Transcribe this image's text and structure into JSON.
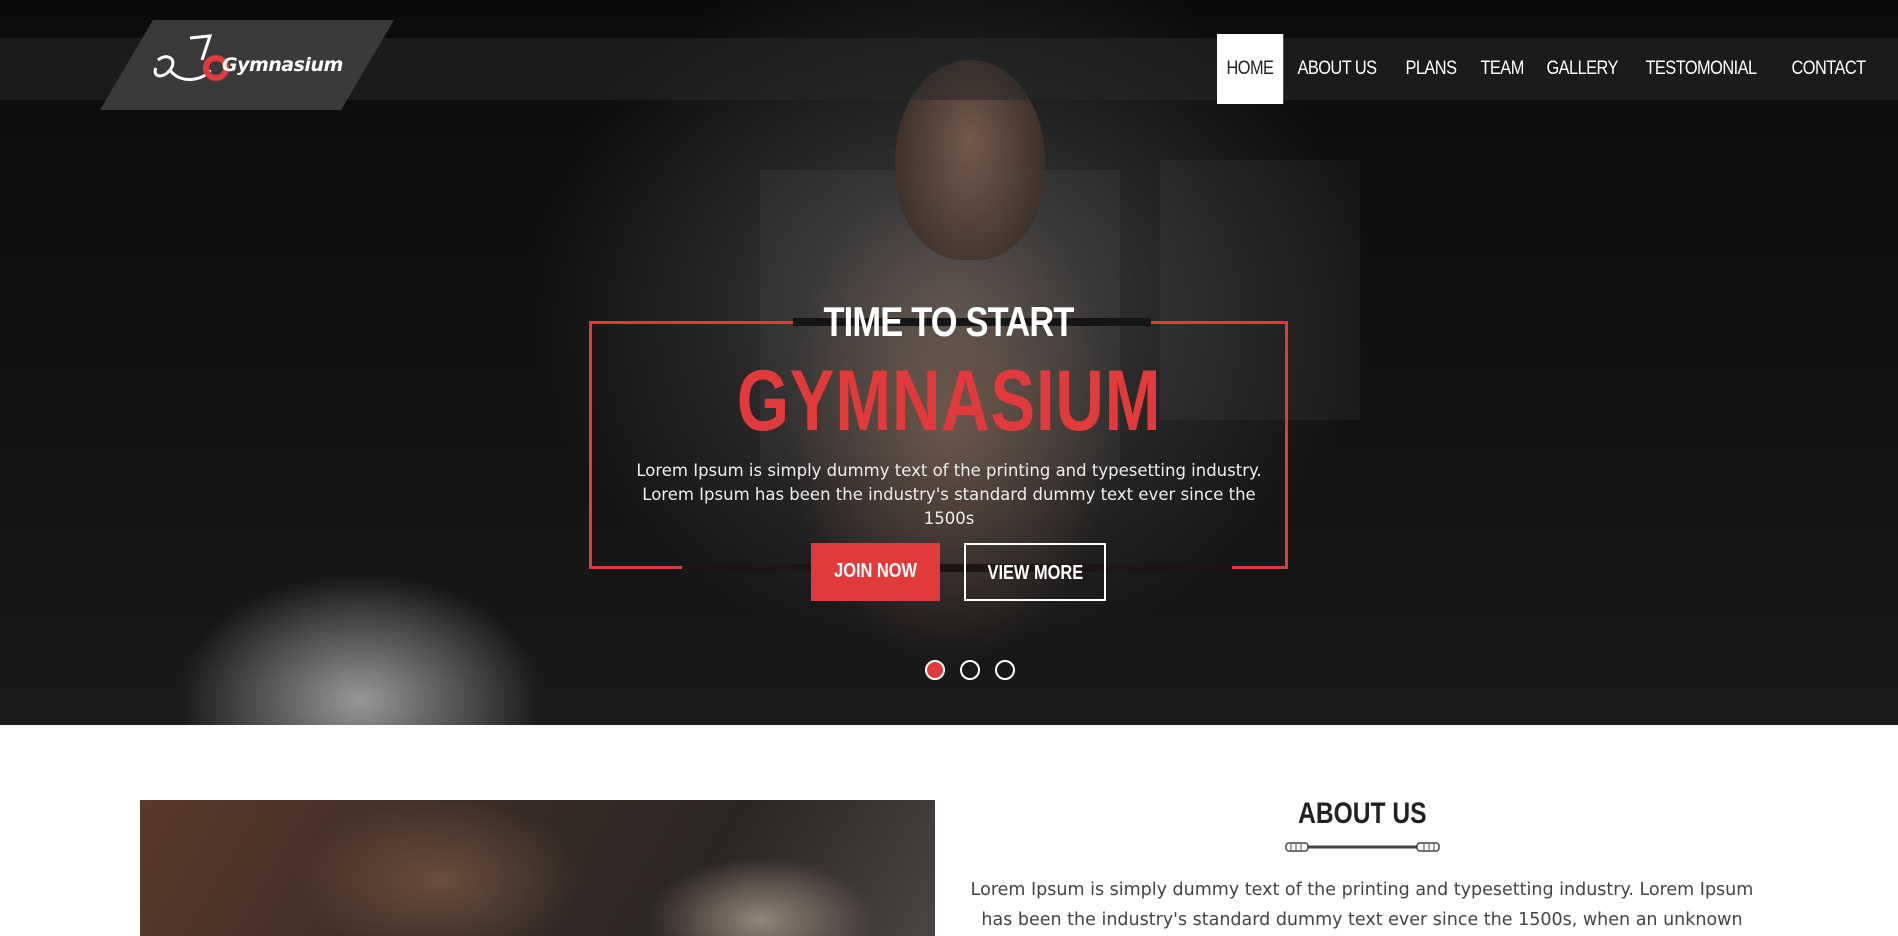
{
  "brand": {
    "logo_text": "Gymnasium"
  },
  "nav": {
    "items": [
      {
        "label": "HOME",
        "active": true
      },
      {
        "label": "ABOUT US",
        "active": false
      },
      {
        "label": "PLANS",
        "active": false
      },
      {
        "label": "TEAM",
        "active": false
      },
      {
        "label": "GALLERY",
        "active": false
      },
      {
        "label": "TESTOMONIAL",
        "active": false
      },
      {
        "label": "CONTACT",
        "active": false
      }
    ]
  },
  "hero": {
    "kicker": "TIME TO START",
    "title": "GYMNASIUM",
    "description": "Lorem Ipsum is simply dummy text of the printing and typesetting industry. Lorem Ipsum has been the industry's standard dummy text ever since the 1500s",
    "join_label": "JOIN NOW",
    "view_label": "VIEW MORE",
    "slides": {
      "count": 3,
      "active_index": 0
    }
  },
  "about": {
    "title": "ABOUT US",
    "text": "Lorem Ipsum is simply dummy text of the printing and typesetting industry. Lorem Ipsum has been the industry's standard dummy text ever since the 1500s, when an unknown printer took a"
  },
  "colors": {
    "accent": "#e03a3a",
    "dark": "#0b0b0b",
    "nav_active_bg": "#ffffff"
  }
}
